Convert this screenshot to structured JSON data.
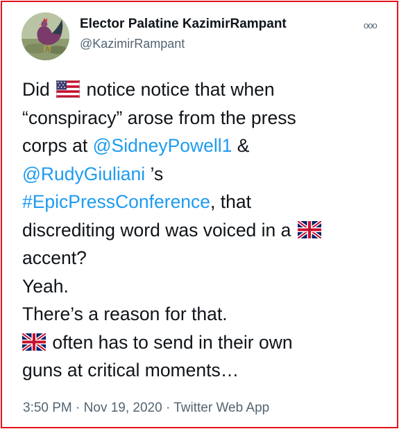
{
  "author": {
    "display_name": "Elector Palatine KazimirRampant",
    "handle": "@KazimirRampant"
  },
  "more_menu_label": "ooo",
  "tweet": {
    "icons": [
      "us-flag-emoji",
      "uk-flag-emoji"
    ],
    "text": {
      "did": "Did",
      "notice": "notice notice that when",
      "conspiracy": "“conspiracy” arose from the press",
      "corps_at": "corps at",
      "mention_sidney": "@SidneyPowell1",
      "amp": "&",
      "mention_rudy": "@RudyGiuliani",
      "possessive": "’s",
      "hashtag": "#EpicPressConference",
      "comma_that": ", that",
      "discrediting": "discrediting word was voiced in a",
      "accent": "accent?",
      "yeah": "Yeah.",
      "reason": "There’s a reason for that.",
      "often": "often has to send in their own",
      "guns": "guns at critical moments…"
    }
  },
  "meta": {
    "time": "3:50 PM",
    "date": "Nov 19, 2020",
    "source": "Twitter Web App",
    "separator": "·"
  },
  "colors": {
    "border": "#e5121b",
    "link": "#1d9bf0",
    "text": "#0f1419",
    "secondary": "#536471"
  }
}
